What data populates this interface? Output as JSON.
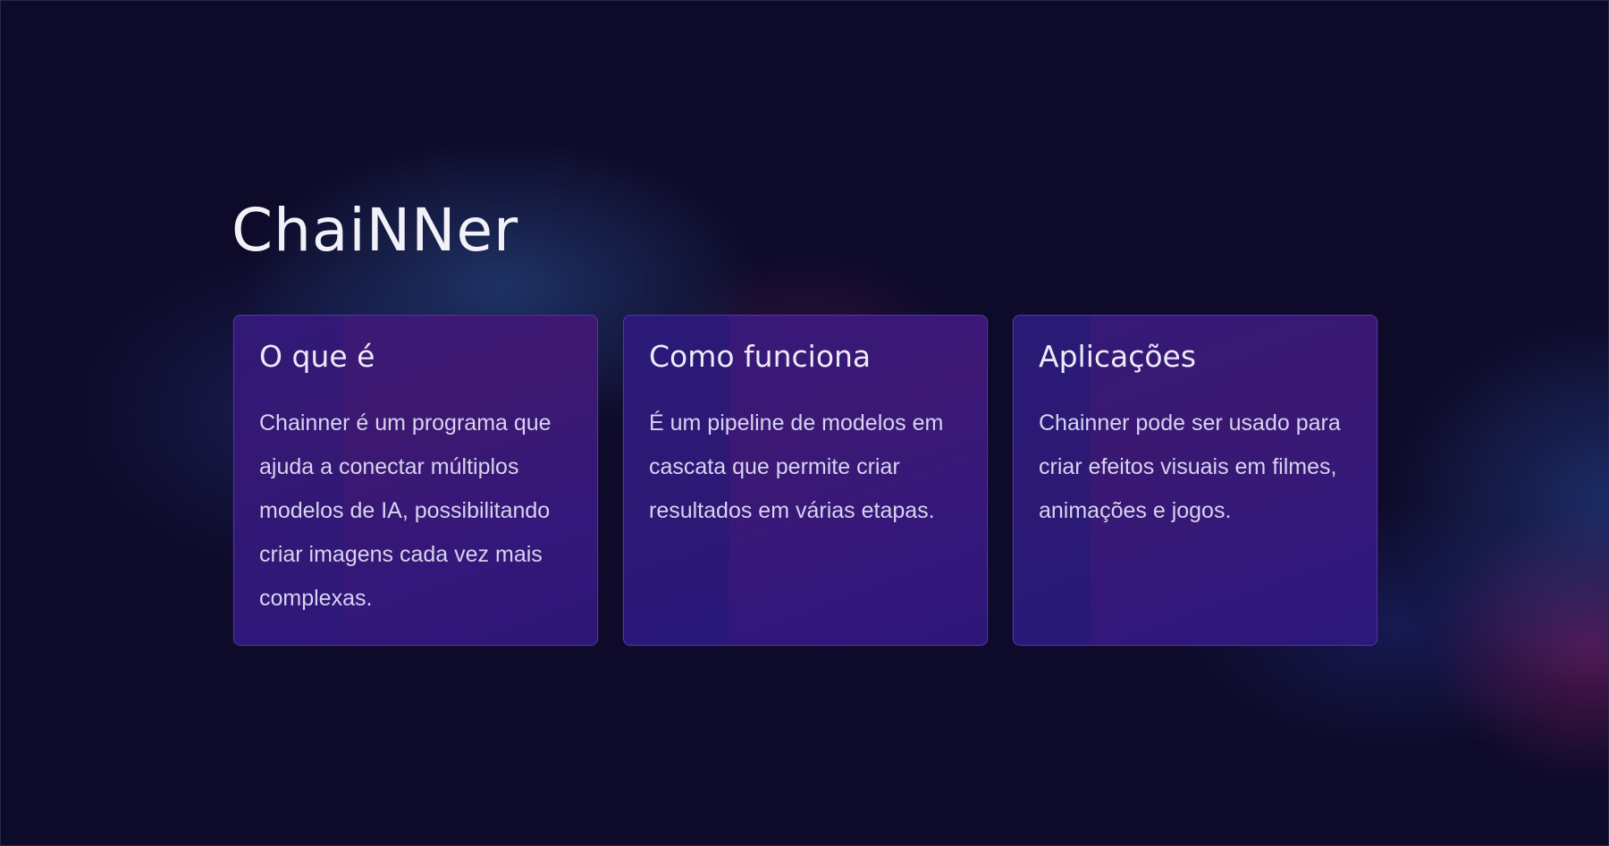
{
  "title": "ChaiNNer",
  "cards": [
    {
      "heading": "O que é",
      "text": "Chainner é um programa que ajuda a conectar múltiplos modelos de IA, possibilitando criar imagens cada vez mais complexas."
    },
    {
      "heading": "Como funciona",
      "text": "É um pipeline de modelos em cascata que permite criar resultados em várias etapas."
    },
    {
      "heading": "Aplicações",
      "text": "Chainner pode ser usado para criar efeitos visuais em filmes, animações e jogos."
    }
  ],
  "colors": {
    "background": "#0e0b2a",
    "card": "#3a1a78",
    "text": "#d7d3ee"
  }
}
